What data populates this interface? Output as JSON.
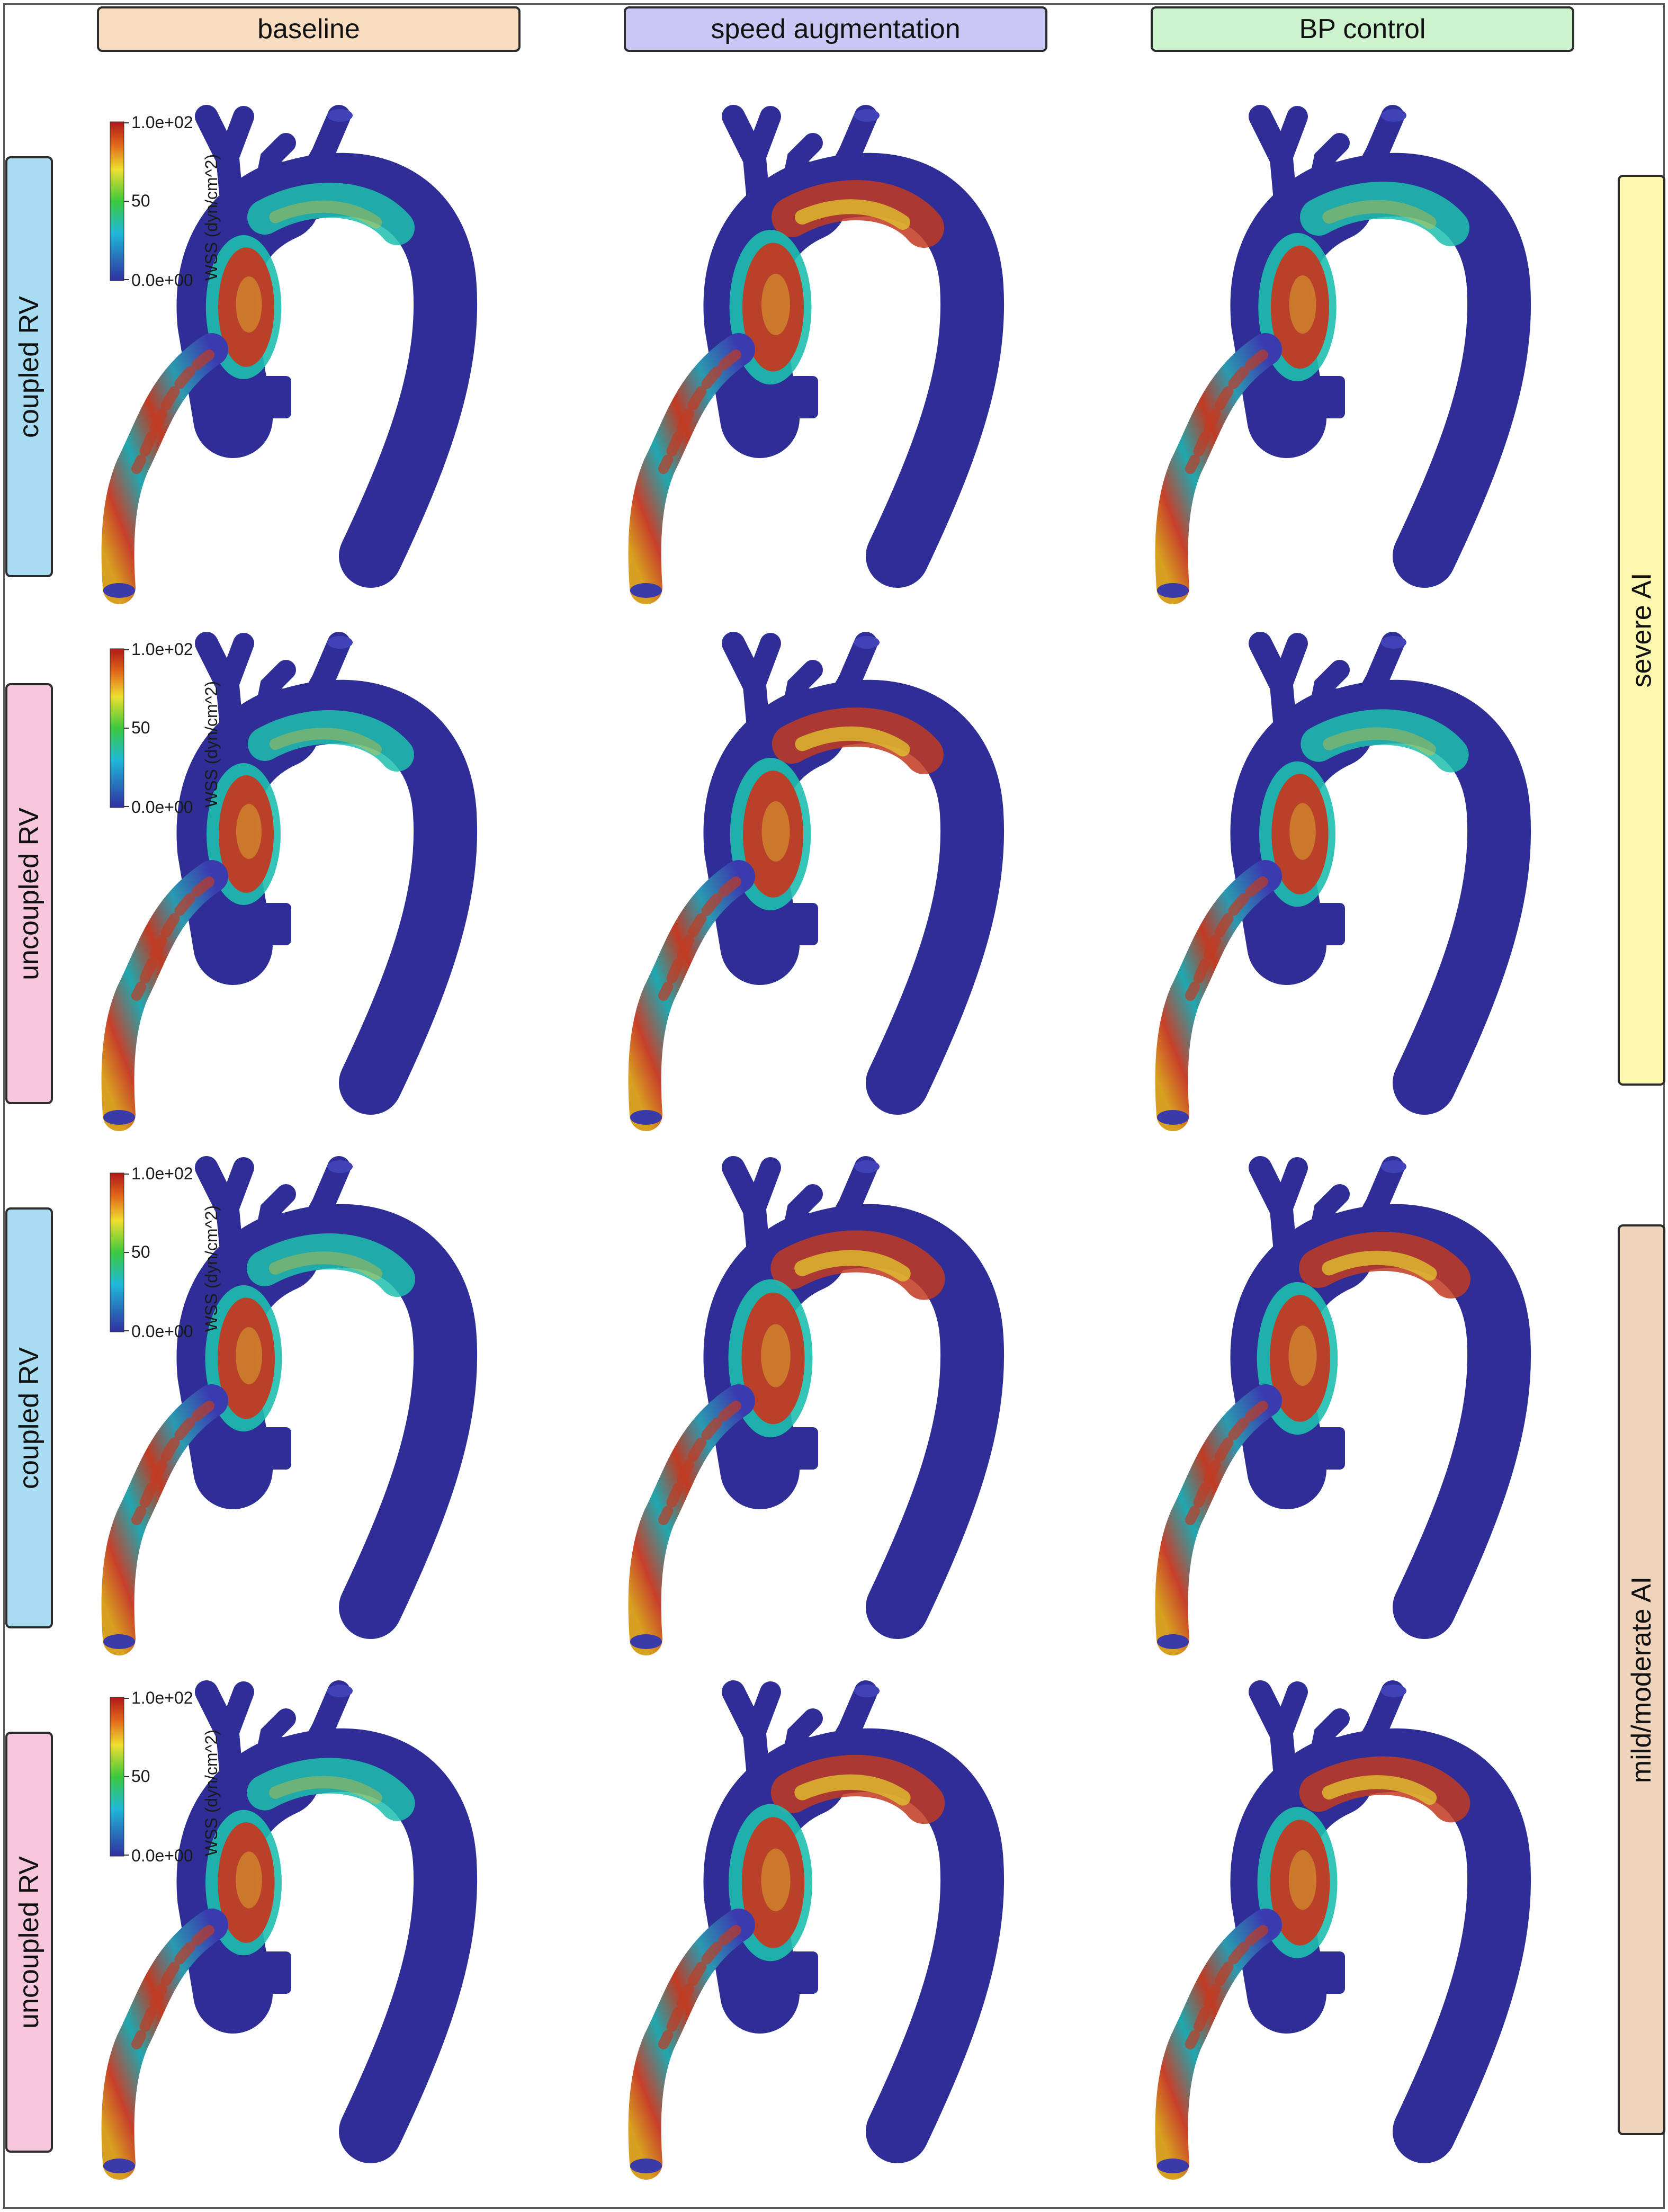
{
  "columns": [
    {
      "label": "baseline",
      "color": "#f8dcc0"
    },
    {
      "label": "speed augmentation",
      "color": "#c9c8f4"
    },
    {
      "label": "BP control",
      "color": "#ccf3cd"
    }
  ],
  "rows": [
    {
      "label": "coupled RV",
      "color": "#a8dcf2"
    },
    {
      "label": "uncoupled RV",
      "color": "#f5c6dc"
    },
    {
      "label": "coupled RV",
      "color": "#a8dcf2"
    },
    {
      "label": "uncoupled RV",
      "color": "#f5c6dc"
    }
  ],
  "groups": [
    {
      "label": "severe AI",
      "color": "#fdf6ad"
    },
    {
      "label": "mild/moderate AI",
      "color": "#efd4bb"
    }
  ],
  "colorbar": {
    "max_label": "1.0e+02",
    "mid_label": "50",
    "min_label": "0.0e+00",
    "title": "WSS (dyn/cm^2)"
  },
  "colors": {
    "vessel_base": "#2e2e96",
    "wss_low": "#3b3bb0",
    "wss_mid": "#1fbfae",
    "wss_high": "#c23a22"
  },
  "wss_levels": [
    [
      0.65,
      0.9,
      0.75
    ],
    [
      0.6,
      0.85,
      0.68
    ],
    [
      0.7,
      0.98,
      0.85
    ],
    [
      0.68,
      0.96,
      0.82
    ]
  ]
}
